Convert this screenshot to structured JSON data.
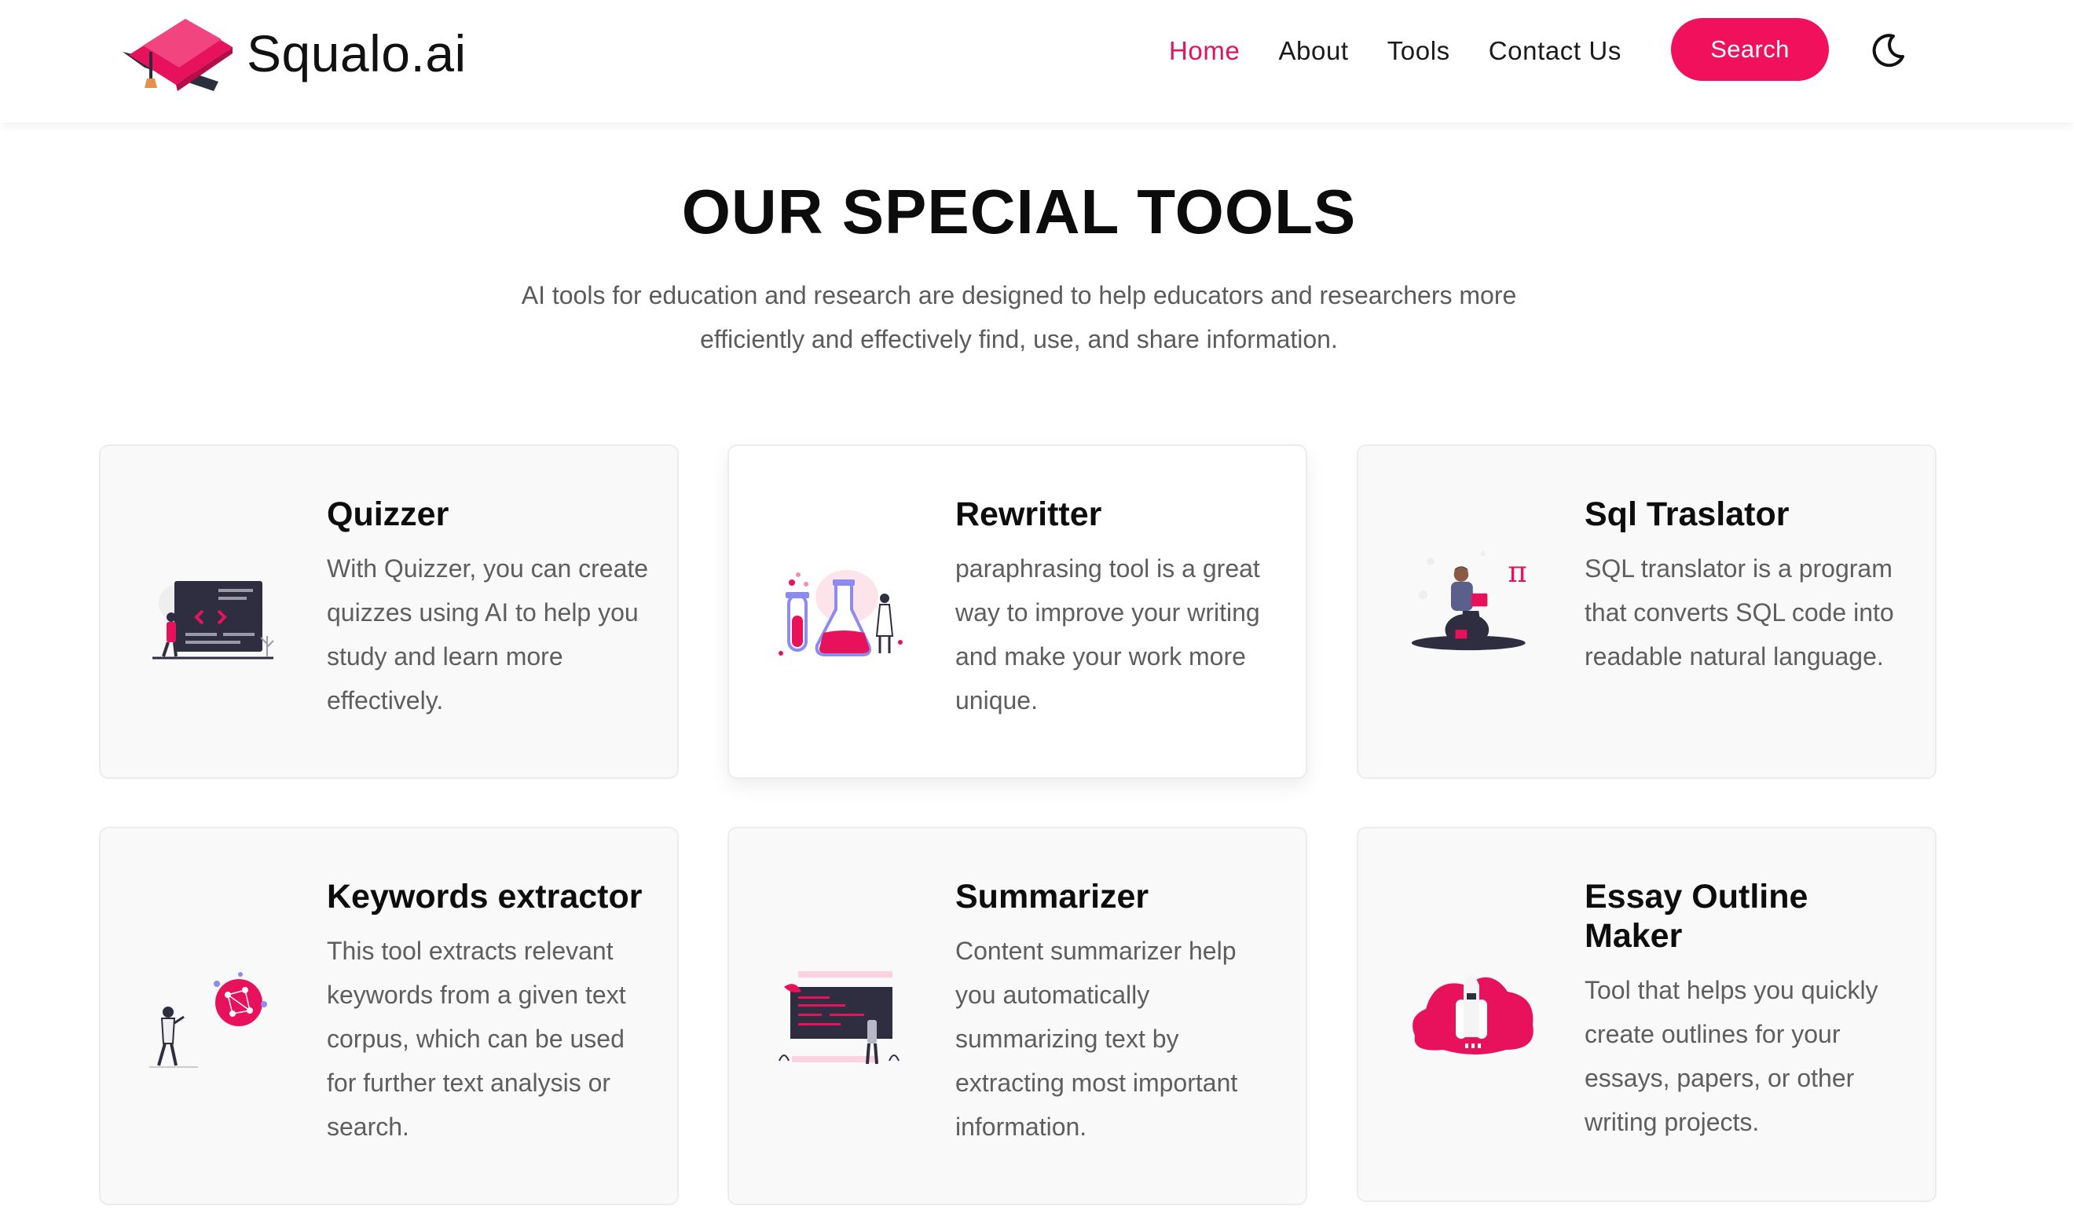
{
  "brand": {
    "name": "Squalo.ai",
    "logo_icon": "graduation-cap-icon",
    "accent": "#f0105c"
  },
  "nav": {
    "items": [
      {
        "label": "Home",
        "active": true
      },
      {
        "label": "About",
        "active": false
      },
      {
        "label": "Tools",
        "active": false
      },
      {
        "label": "Contact Us",
        "active": false
      }
    ],
    "search_label": "Search",
    "theme_toggle_icon": "moon-icon"
  },
  "section": {
    "title": "OUR SPECIAL TOOLS",
    "subtitle": "AI tools for education and research are designed to help educators and researchers more efficiently and effectively find, use, and share information."
  },
  "tools": [
    {
      "title": "Quizzer",
      "description": "With Quizzer, you can create quizzes using AI to help you study and learn more effectively.",
      "icon": "code-board-illustration"
    },
    {
      "title": "Rewritter",
      "description": "paraphrasing tool is a great way to improve your writing and make your work more unique.",
      "icon": "lab-flasks-illustration"
    },
    {
      "title": "Sql Traslator",
      "description": "SQL translator is a program that converts SQL code into readable natural language.",
      "icon": "person-reading-pi-illustration"
    },
    {
      "title": "Keywords extractor",
      "description": "This tool extracts relevant keywords from a given text corpus, which can be used for further text analysis or search.",
      "icon": "person-network-illustration"
    },
    {
      "title": "Summarizer",
      "description": "Content summarizer help you automatically summarizing text by extracting most important information.",
      "icon": "presentation-board-illustration"
    },
    {
      "title": "Essay Outline Maker",
      "description": "Tool that helps you quickly create outlines for your essays, papers, or other writing projects.",
      "icon": "rocket-launch-illustration"
    }
  ]
}
